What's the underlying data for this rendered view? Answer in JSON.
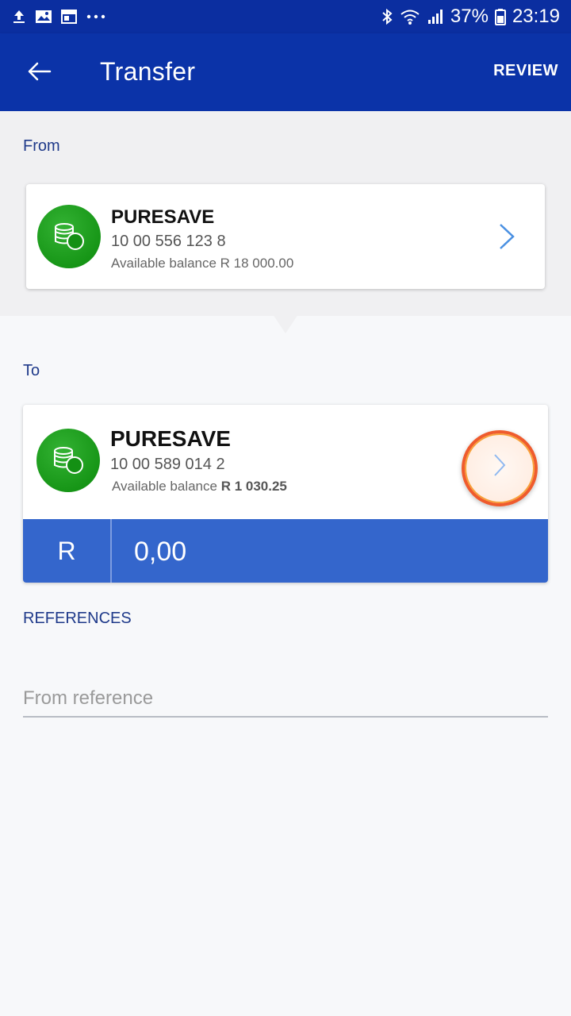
{
  "status_bar": {
    "battery": "37%",
    "time": "23:19",
    "icons_left": [
      "upload-icon",
      "image-icon",
      "widget-icon",
      "more-icon"
    ],
    "icons_right": [
      "bluetooth-icon",
      "wifi-icon",
      "signal-icon",
      "battery-icon"
    ]
  },
  "header": {
    "title": "Transfer",
    "review_label": "REVIEW"
  },
  "from": {
    "label": "From",
    "account_name": "PURESAVE",
    "account_number": "10 00 556 123 8",
    "balance_text": "Available balance R 18 000.00"
  },
  "to": {
    "label": "To",
    "account_name": "PURESAVE",
    "account_number": "10 00 589 014 2",
    "balance_prefix": "Available balance",
    "balance_value": "R 1 030.25"
  },
  "amount": {
    "currency": "R",
    "value": "0,00"
  },
  "references": {
    "label": "REFERENCES",
    "from_placeholder": "From reference"
  },
  "colors": {
    "app_bar": "#0b33a8",
    "amount_bar": "#3466cc",
    "label_text": "#1f3a8a",
    "account_icon": "#1a9a1a",
    "chevron": "#4a90e2"
  }
}
